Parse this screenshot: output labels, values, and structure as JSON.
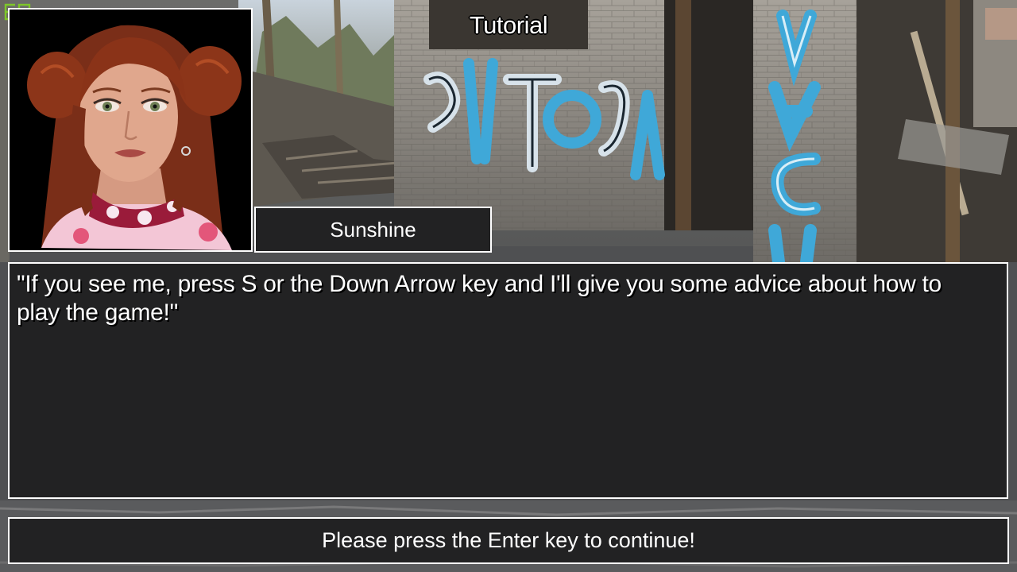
{
  "hud": {
    "fps_counter": "60",
    "fps_color": "#7ec62a"
  },
  "header": {
    "title": "Tutorial"
  },
  "speaker": {
    "name": "Sunshine",
    "portrait": "redhead-girl-portrait"
  },
  "dialog": {
    "text": "\"If you see me, press S or the Down Arrow key and I'll give you some advice about how to play the game!\""
  },
  "prompt": {
    "continue_text": "Please press the Enter key to continue!"
  },
  "background": {
    "scene": "graffiti-ruins",
    "graffiti_color": "#3fa8d8"
  }
}
